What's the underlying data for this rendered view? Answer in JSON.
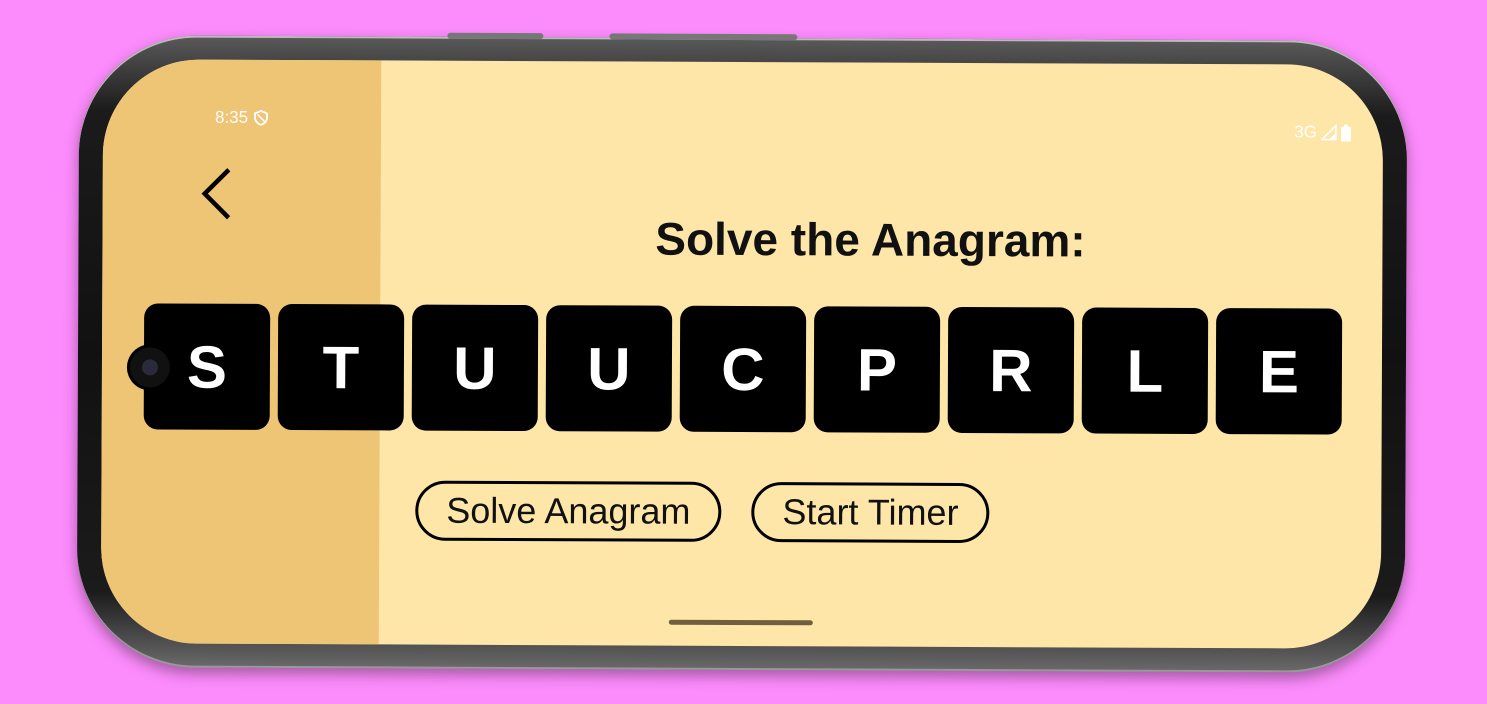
{
  "status_bar": {
    "time": "8:35",
    "network": "3G",
    "icons": [
      "shield-icon",
      "signal-icon",
      "battery-icon"
    ]
  },
  "nav": {
    "back_icon": "chevron-left-icon"
  },
  "main": {
    "title": "Solve the Anagram:",
    "letters": [
      "S",
      "T",
      "U",
      "U",
      "C",
      "P",
      "R",
      "L",
      "E"
    ],
    "solve_button_label": "Solve Anagram",
    "timer_button_label": "Start Timer"
  },
  "colors": {
    "background": "#fc8bfc",
    "screen": "#fde6a8",
    "left_pane": "#eec475",
    "tile": "#000000",
    "tile_text": "#ffffff"
  }
}
